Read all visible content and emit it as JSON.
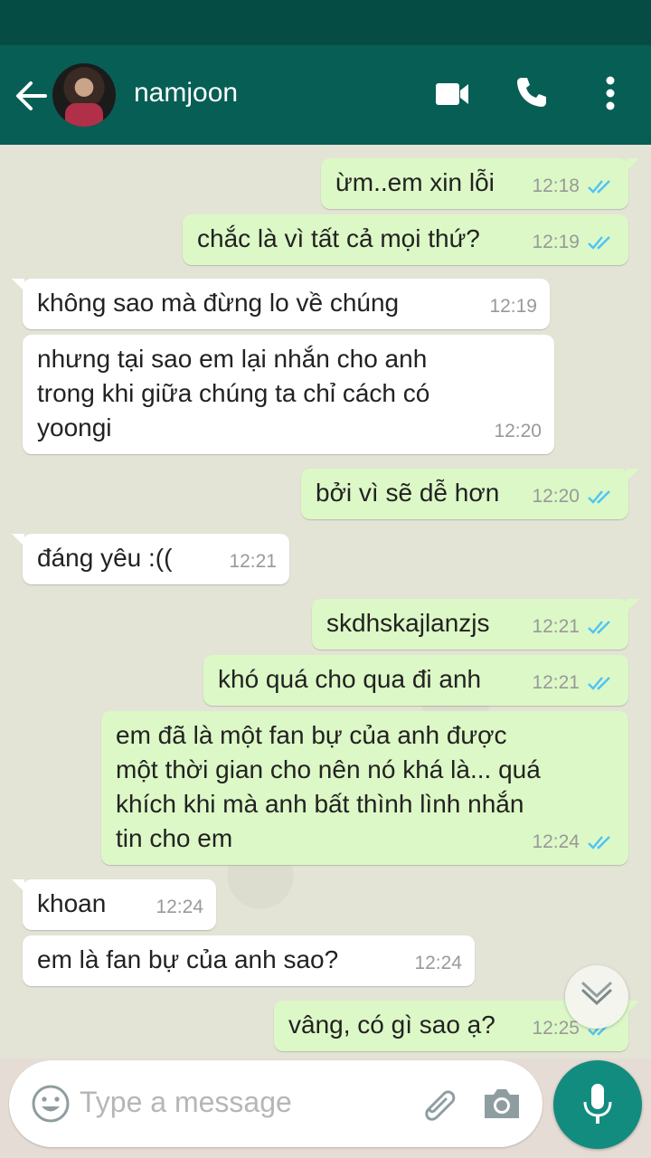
{
  "header": {
    "contact_name": "namjoon",
    "icons": [
      "back-arrow-icon",
      "video-call-icon",
      "phone-icon",
      "more-vert-icon"
    ]
  },
  "messages": [
    {
      "dir": "out",
      "text": "ừm..em xin lỗi",
      "time": "12:18",
      "read": true
    },
    {
      "dir": "out",
      "text": "chắc là vì tất cả mọi thứ?",
      "time": "12:19",
      "read": true
    },
    {
      "dir": "in",
      "text": "không sao mà đừng lo về chúng",
      "time": "12:19"
    },
    {
      "dir": "in",
      "text": "nhưng tại sao em lại nhắn cho anh\ntrong khi giữa chúng ta chỉ cách có\nyoongi",
      "time": "12:20"
    },
    {
      "dir": "out",
      "text": "bởi vì sẽ dễ hơn",
      "time": "12:20",
      "read": true
    },
    {
      "dir": "in",
      "text": "đáng yêu :((",
      "time": "12:21"
    },
    {
      "dir": "out",
      "text": "skdhskajlanzjs",
      "time": "12:21",
      "read": true
    },
    {
      "dir": "out",
      "text": "khó quá cho qua đi anh",
      "time": "12:21",
      "read": true
    },
    {
      "dir": "out",
      "text": "em đã là một fan bự của anh được\nmột thời gian cho nên nó khá là... quá\nkhích khi mà anh bất thình lình nhắn\ntin cho em",
      "time": "12:24",
      "read": true
    },
    {
      "dir": "in",
      "text": "khoan",
      "time": "12:24"
    },
    {
      "dir": "in",
      "text": "em là fan bự của anh sao?",
      "time": "12:24"
    },
    {
      "dir": "out",
      "text": "vâng, có gì sao ạ?",
      "time": "12:25",
      "read": true
    }
  ],
  "composer": {
    "placeholder": "Type a message",
    "icons": [
      "emoji-icon",
      "attach-icon",
      "camera-icon",
      "mic-icon"
    ]
  },
  "colors": {
    "header": "#075e54",
    "statusbar": "#054d44",
    "outgoing_bubble": "#dcf8c6",
    "incoming_bubble": "#ffffff",
    "read_ticks": "#4fc3f7",
    "mic_button": "#128c7e"
  }
}
